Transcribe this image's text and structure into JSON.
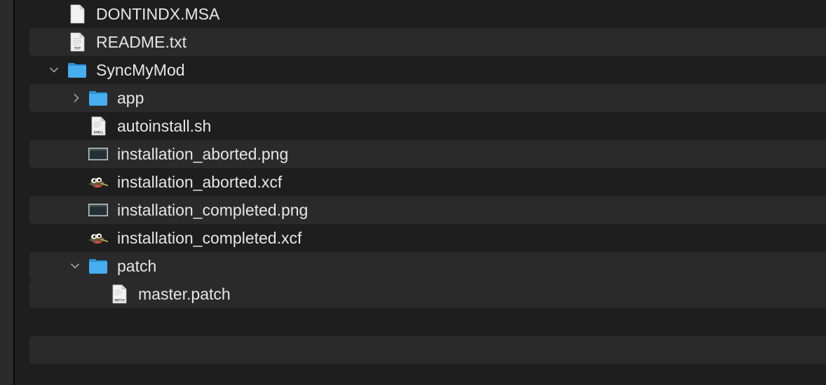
{
  "file_list": {
    "items": [
      {
        "name": "DONTINDX.MSA",
        "kind": "document-icon"
      },
      {
        "name": "README.txt",
        "kind": "text-document-icon",
        "badge": "TXT"
      },
      {
        "name": "SyncMyMod",
        "kind": "folder-icon",
        "disclosure": "expanded"
      },
      {
        "name": "app",
        "kind": "folder-icon",
        "disclosure": "collapsed"
      },
      {
        "name": "autoinstall.sh",
        "kind": "shell-script-icon",
        "badge": "SHELL"
      },
      {
        "name": "installation_aborted.png",
        "kind": "png-image-icon"
      },
      {
        "name": "installation_aborted.xcf",
        "kind": "gimp-file-icon"
      },
      {
        "name": "installation_completed.png",
        "kind": "png-image-icon"
      },
      {
        "name": "installation_completed.xcf",
        "kind": "gimp-file-icon"
      },
      {
        "name": "patch",
        "kind": "folder-icon",
        "disclosure": "expanded"
      },
      {
        "name": "master.patch",
        "kind": "patch-file-icon",
        "badge": "PATCH"
      }
    ]
  },
  "colors": {
    "background": "#1e1e1e",
    "stripe": "#2a2a2a",
    "text": "#e6e6e6",
    "folder": "#3ea6ee"
  }
}
